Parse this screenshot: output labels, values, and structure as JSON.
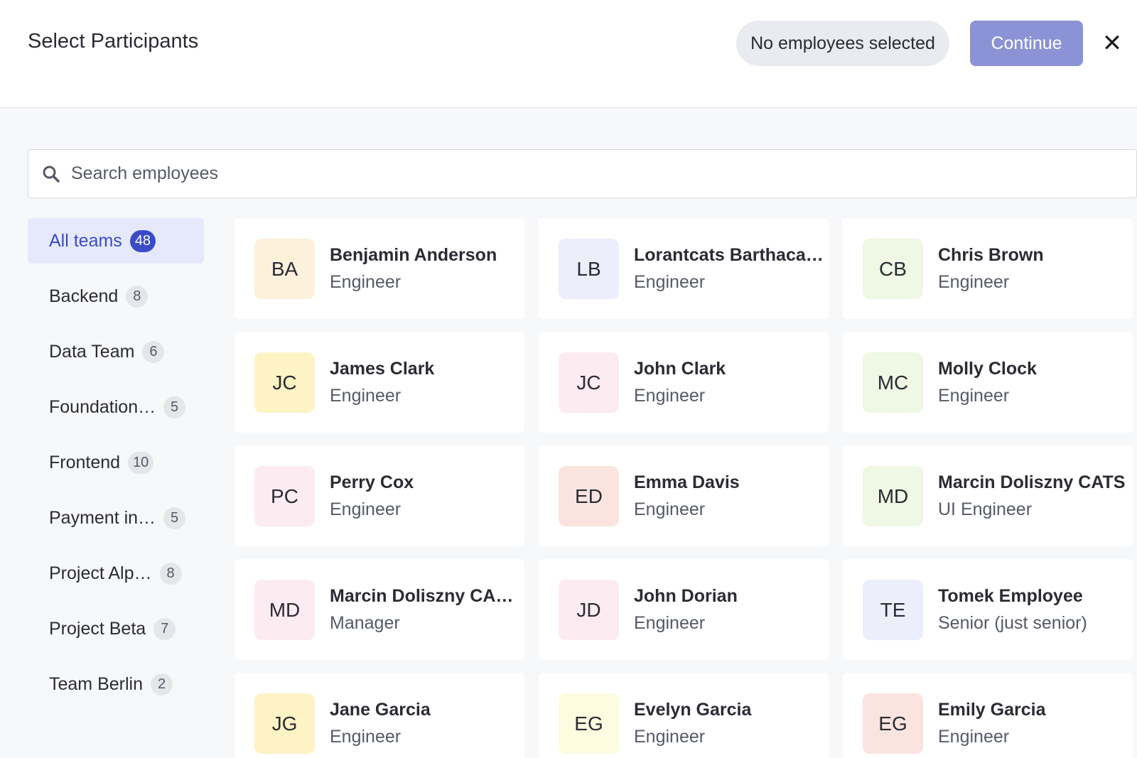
{
  "header": {
    "title": "Select Participants",
    "status": "No employees selected",
    "continue_label": "Continue",
    "close_glyph": "✕"
  },
  "search": {
    "placeholder": "Search employees",
    "icon": "search-icon"
  },
  "teams": [
    {
      "label": "All teams",
      "count": "48",
      "active": true
    },
    {
      "label": "Backend",
      "count": "8"
    },
    {
      "label": "Data Team",
      "count": "6"
    },
    {
      "label": "Foundation…",
      "count": "5"
    },
    {
      "label": "Frontend",
      "count": "10"
    },
    {
      "label": "Payment in…",
      "count": "5"
    },
    {
      "label": "Project Alp…",
      "count": "8"
    },
    {
      "label": "Project Beta",
      "count": "7"
    },
    {
      "label": "Team Berlin",
      "count": "2"
    }
  ],
  "employees": [
    {
      "initials": "BA",
      "name": "Benjamin Anderson",
      "role": "Engineer",
      "color": "#fdf1dc"
    },
    {
      "initials": "LB",
      "name": "Lorantcats Barthaca…",
      "role": "Engineer",
      "color": "#eceefb"
    },
    {
      "initials": "CB",
      "name": "Chris Brown",
      "role": "Engineer",
      "color": "#eef8e4"
    },
    {
      "initials": "JC",
      "name": "James Clark",
      "role": "Engineer",
      "color": "#fdf3c4"
    },
    {
      "initials": "JC",
      "name": "John Clark",
      "role": "Engineer",
      "color": "#fcebf0"
    },
    {
      "initials": "MC",
      "name": "Molly Clock",
      "role": "Engineer",
      "color": "#eef8e4"
    },
    {
      "initials": "PC",
      "name": "Perry Cox",
      "role": "Engineer",
      "color": "#fcebf0"
    },
    {
      "initials": "ED",
      "name": "Emma Davis",
      "role": "Engineer",
      "color": "#fbe4e0"
    },
    {
      "initials": "MD",
      "name": "Marcin Doliszny CATS",
      "role": "UI Engineer",
      "color": "#eef8e4"
    },
    {
      "initials": "MD",
      "name": "Marcin Doliszny CA…",
      "role": "Manager",
      "color": "#fcebf0"
    },
    {
      "initials": "JD",
      "name": "John Dorian",
      "role": "Engineer",
      "color": "#fcebf0"
    },
    {
      "initials": "TE",
      "name": "Tomek Employee",
      "role": "Senior (just senior)",
      "color": "#eceefb"
    },
    {
      "initials": "JG",
      "name": "Jane Garcia",
      "role": "Engineer",
      "color": "#fdf3c4"
    },
    {
      "initials": "EG",
      "name": "Evelyn Garcia",
      "role": "Engineer",
      "color": "#fdfbe0"
    },
    {
      "initials": "EG",
      "name": "Emily Garcia",
      "role": "Engineer",
      "color": "#fbe4e0"
    }
  ]
}
